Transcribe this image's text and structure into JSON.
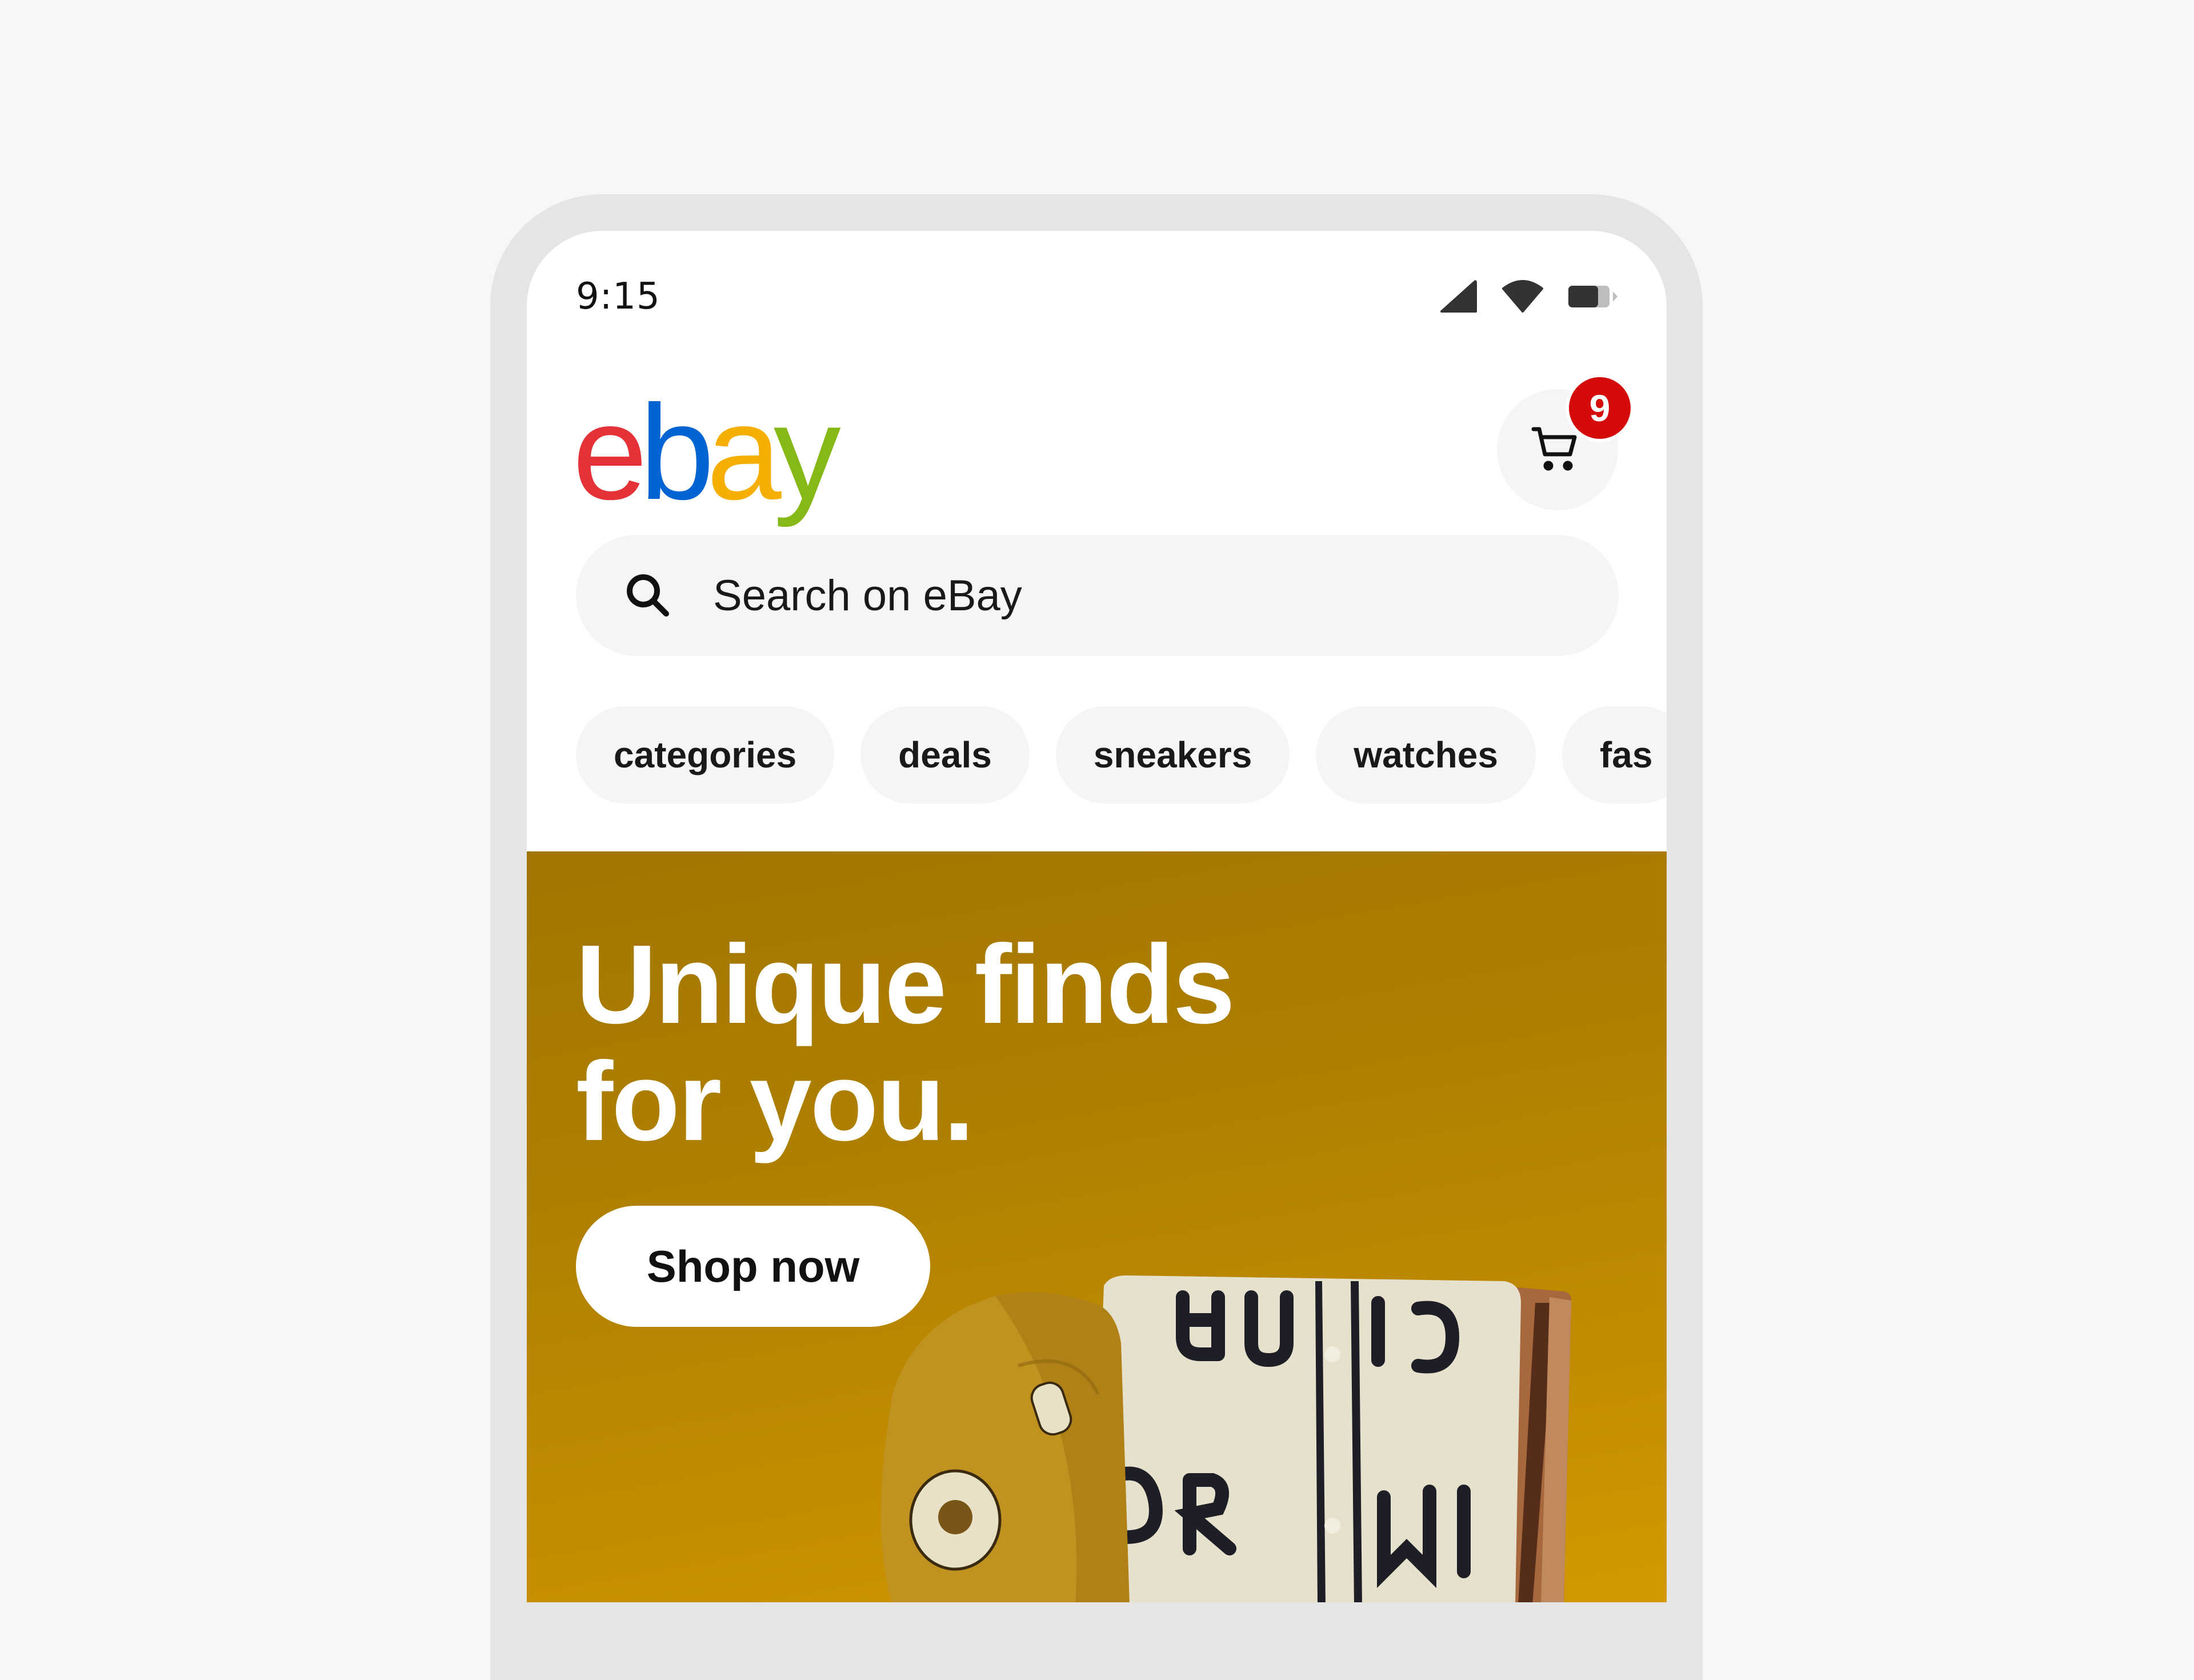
{
  "status_bar": {
    "time": "9:15",
    "icons": [
      "cellular-signal-icon",
      "wifi-icon",
      "battery-icon"
    ],
    "battery_level_percent": 70
  },
  "header": {
    "logo": {
      "letters": [
        "e",
        "b",
        "a",
        "y"
      ],
      "colors": [
        "#E53238",
        "#0064D2",
        "#F5AF02",
        "#86B817"
      ]
    },
    "cart": {
      "icon": "shopping-cart-icon",
      "badge_count": "9",
      "badge_color": "#D50B0B"
    }
  },
  "search": {
    "icon": "search-icon",
    "placeholder": "Search on eBay",
    "value": ""
  },
  "chips": [
    {
      "label": "categories"
    },
    {
      "label": "deals"
    },
    {
      "label": "sneakers"
    },
    {
      "label": "watches"
    },
    {
      "label": "fas"
    }
  ],
  "hero_banner": {
    "headline_line1": "Unique finds",
    "headline_line2": "for you.",
    "cta_label": "Shop now",
    "background_color": "#B58400",
    "image_description": "mustard corduroy cap and cream baseball jersey draped on a wooden chair"
  }
}
